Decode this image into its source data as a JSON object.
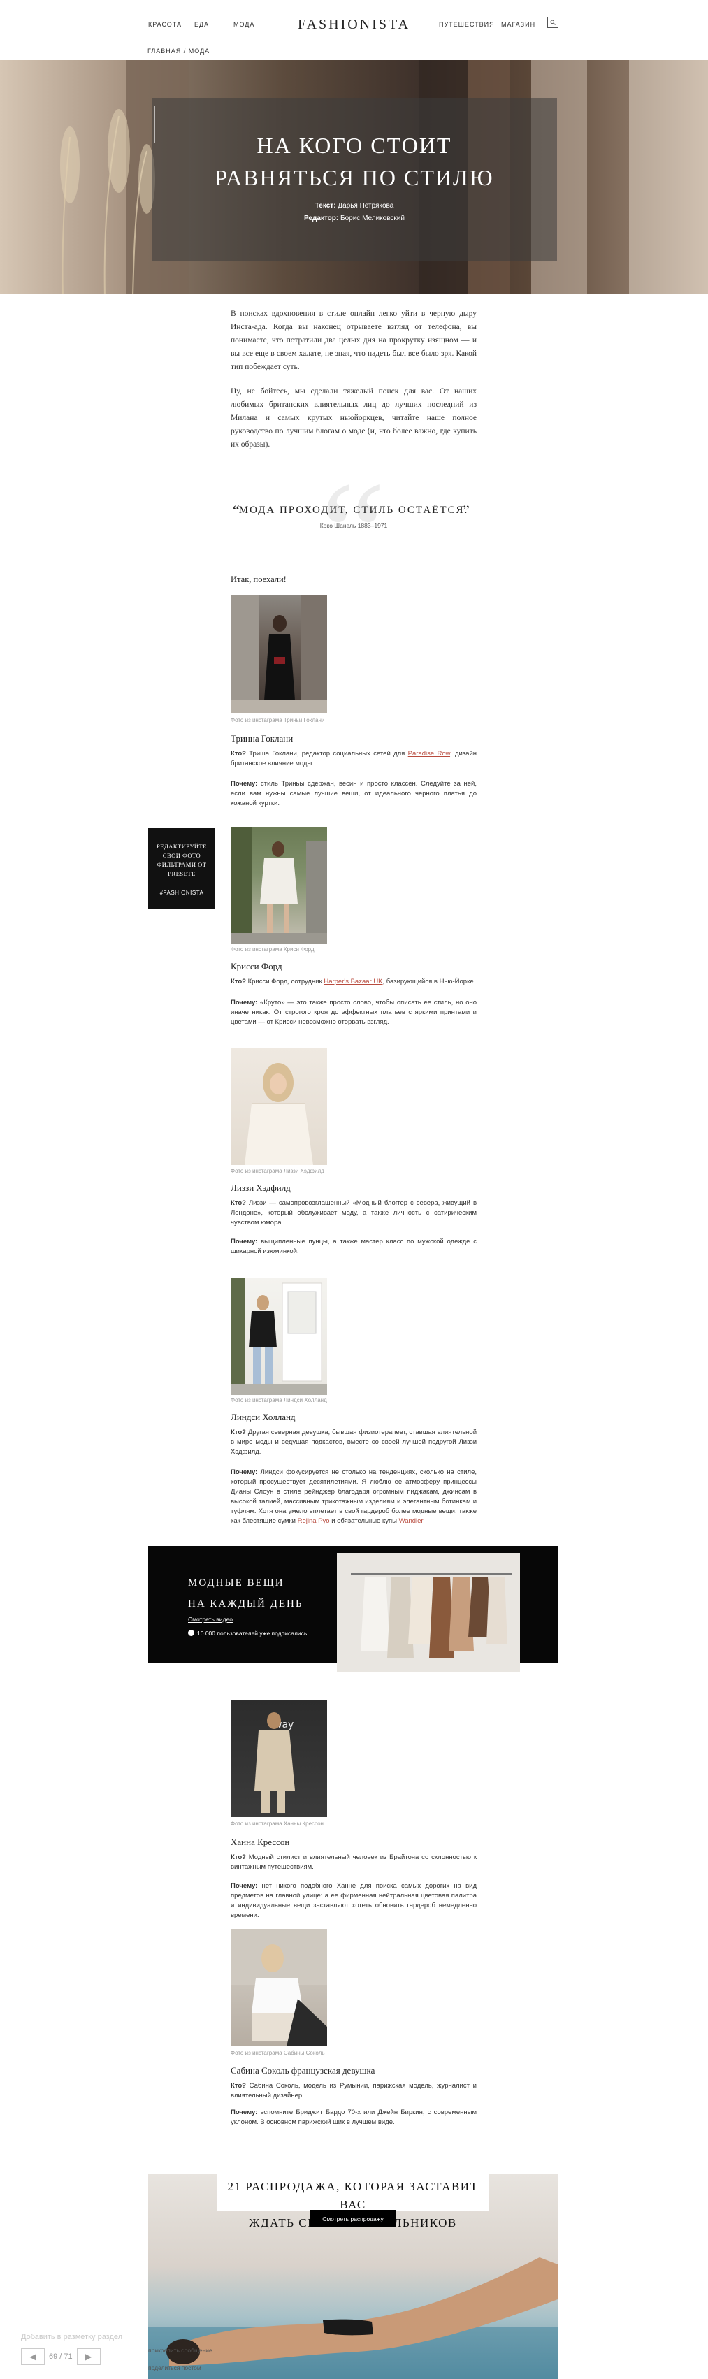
{
  "header": {
    "nav": [
      "Красота",
      "Еда",
      "Мода"
    ],
    "nav_right": [
      "Путешествия",
      "Магазин"
    ],
    "logo": "FASHIONISTA",
    "breadcrumb": "Главная / Мода"
  },
  "hero": {
    "title_line1": "На кого стоит",
    "title_line2": "равняться по стилю",
    "text_label": "Текст:",
    "text_author": "Дарья Петрякова",
    "editor_label": "Редактор:",
    "editor_name": "Борис Меликовский"
  },
  "intro": {
    "p1": "В поисках вдохновения в стиле онлайн легко уйти в черную дыру Инста-ада. Когда вы наконец отрываете взгляд от телефона, вы понимаете, что потратили два целых дня на прокрутку изящном — и вы все еще в своем халате, не зная, что надеть был все было зря. Какой тип побеждает суть.",
    "p2": "Ну, не бойтесь, мы сделали тяжелый поиск для вас. От наших любимых британских влиятельных лиц до лучших последний из Милана и самых крутых ньюйоркцев, читайте наше полное руководство по лучшим блогам о моде (и, что более важно, где купить их образы)."
  },
  "quote": {
    "text": "Мода проходит, стиль остаётся.",
    "author": "Коко Шанель 1883–1971"
  },
  "lead": "Итак, поехали!",
  "promo": {
    "text": "Редактируйте свои фото фильтрами от PRESETE",
    "tag": "#FASHIONISTA"
  },
  "people": [
    {
      "caption": "Фото из инстаграма Триньи Гоклани",
      "name": "Тринна Гоклани",
      "who_label": "Кто?",
      "who": "Триша Гоклани, редактор социальных сетей для",
      "who_link": "Paradise Row",
      "who_tail": ", дизайн британское влияние моды.",
      "why_label": "Почему:",
      "why": "стиль Триньы сдержан, весин и просто классен. Следуйте за ней, если вам нужны самые лучшие вещи, от идеального черного платья до кожаной куртки."
    },
    {
      "caption": "Фото из инстаграма Криси Форд",
      "name": "Крисси Форд",
      "who_label": "Кто?",
      "who": "Крисси Форд, сотрудник",
      "who_link": "Harper's Bazaar UK",
      "who_tail": ", базирующийся в Нью-Йорке.",
      "why_label": "Почему:",
      "why": "«Круто» — это также просто слово, чтобы описать ее стиль, но оно иначе никак. От строгого кроя до эффектных платьев с яркими принтами и цветами — от Крисси невозможно оторвать взгляд."
    },
    {
      "caption": "Фото из инстаграма Лиззи Хэдфилд",
      "name": "Лиззи Хэдфилд",
      "who_label": "Кто?",
      "who": "Лиззи — самопровозглашенный «Модный блоггер с севера, живущий в Лондоне», который обслуживает моду, а также личность с сатирическим чувством юмора.",
      "who_link": "",
      "who_tail": "",
      "why_label": "Почему:",
      "why": "выщипленные пунцы, а также мастер класс по мужской одежде с шикарной изюминкой."
    },
    {
      "caption": "Фото из инстаграма Линдси Холланд",
      "name": "Линдси Холланд",
      "who_label": "Кто?",
      "who": "Другая северная девушка, бывшая физиотерапевт, ставшая влиятельной в мире моды и ведущая подкастов, вместе со своей лучшей подругой Лиззи Хэдфилд.",
      "who_link": "",
      "who_tail": "",
      "why_label": "Почему:",
      "why": "Линдси фокусируется не столько на тенденциях, сколько на стиле, который просуществует десятилетиями. Я люблю ее атмосферу принцессы Дианы Слоун в стиле рейнджер благодаря огромным пиджакам, джинсам в высокой талией, массивным трикотажным изделиям и элегантным ботинкам и туфлям. Хотя она умело вплетает в свой гардероб более модные вещи, также как блестящие сумки",
      "why_link1": "Rejina Pyo",
      "why_mid": " и обязательные купы",
      "why_link2": "Wandler",
      "why_tail": "."
    },
    {
      "caption": "Фото из инстаграма Ханны Крессон",
      "name": "Ханна Крессон",
      "who_label": "Кто?",
      "who": "Модный стилист и влиятельный человек из Брайтона со склонностью к винтажным путешествиям.",
      "who_link": "",
      "who_tail": "",
      "why_label": "Почему:",
      "why": "нет никого подобного Ханне для поиска самых дорогих на вид предметов на главной улице: а ее фирменная нейтральная цветовая палитра и индивидуальные вещи заставляют хотеть обновить гардероб немедленно времени."
    },
    {
      "caption": "Фото из инстаграма Сабины Соколь",
      "name": "Сабина Соколь французская девушка",
      "who_label": "Кто?",
      "who": "Сабина Соколь, модель из Румынии, парижская модель, журналист и влиятельный дизайнер.",
      "who_link": "",
      "who_tail": "",
      "why_label": "Почему:",
      "why": "вспомните Бриджит Бардо 70-х или Джейн Биркин, с современным уклоном. В основном парижский шик в лучшем виде."
    }
  ],
  "newsletter": {
    "title_line1": "Модные вещи",
    "title_line2": "на каждый день",
    "link": "Смотреть видео",
    "subscribers": "10 000 пользователей уже подписались"
  },
  "sale": {
    "title_line1": "21 распродажа, которая заставит вас",
    "title_line2": "ждать сезона купальников",
    "button": "Смотреть распродажу"
  },
  "gallery": {
    "note": "Добавить в разметку раздел",
    "counter": "69 / 71",
    "attach": "прикрепить сообщение",
    "share": "поделиться постом"
  }
}
